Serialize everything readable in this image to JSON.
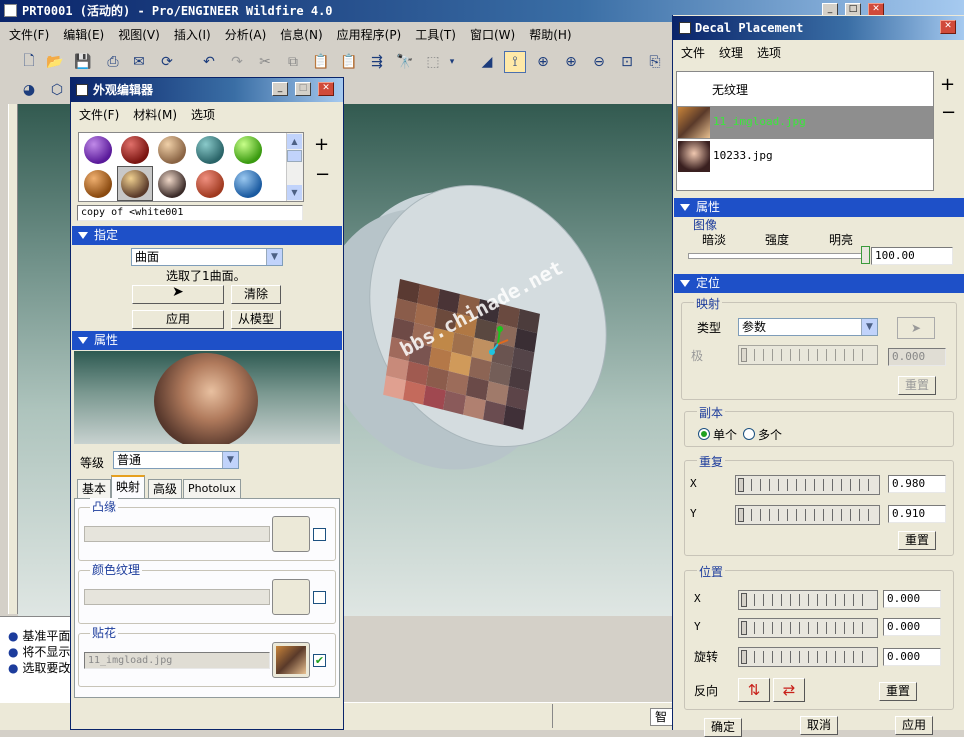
{
  "main_window": {
    "title": "PRT0001 (活动的) - Pro/ENGINEER Wildfire 4.0",
    "menu": [
      "文件(F)",
      "编辑(E)",
      "视图(V)",
      "插入(I)",
      "分析(A)",
      "信息(N)",
      "应用程序(P)",
      "工具(T)",
      "窗口(W)",
      "帮助(H)"
    ],
    "messages": [
      "基准平面",
      "将不显示",
      "选取要改"
    ],
    "status_right": "智",
    "watermark": "bbs.chinade.net"
  },
  "appearance_editor": {
    "title": "外观编辑器",
    "menu": [
      "文件(F)",
      "材料(M)",
      "选项"
    ],
    "material_name": "copy of <white001",
    "add_label": "+",
    "remove_label": "−",
    "assign": {
      "header": "指定",
      "surface_select": "曲面",
      "status": "选取了1曲面。",
      "clear_button": "清除",
      "apply_button": "应用",
      "from_model_button": "从模型"
    },
    "properties": {
      "header": "属性",
      "level_label": "等级",
      "level_value": "普通",
      "tabs": [
        "基本",
        "映射",
        "高级",
        "Photolux"
      ],
      "active_tab": "映射",
      "bump_label": "凸缘",
      "color_texture_label": "颜色纹理",
      "decal_label": "贴花",
      "decal_file": "11_imgload.jpg"
    }
  },
  "decal_placement": {
    "title": "Decal Placement",
    "menu": [
      "文件",
      "纹理",
      "选项"
    ],
    "textures": [
      {
        "name": "无纹理"
      },
      {
        "name": "11_imgload.jpg"
      },
      {
        "name": "10233.jpg"
      }
    ],
    "selected_texture": "11_imgload.jpg",
    "add_label": "+",
    "remove_label": "−",
    "properties": {
      "header": "属性",
      "image_label": "图像",
      "fade_label": "暗淡",
      "intensity_label": "强度",
      "bright_label": "明亮",
      "intensity_value": "100.00"
    },
    "orientation": {
      "header": "定位",
      "mapping_group": "映射",
      "type_label": "类型",
      "type_value": "参数",
      "pole_label": "极",
      "pole_value": "0.000",
      "mapping_reset": "重置",
      "copies_group": "副本",
      "single_label": "单个",
      "multiple_label": "多个",
      "copies_selected": "单个",
      "repeat_group": "重复",
      "repeat_x_label": "X",
      "repeat_x": "0.980",
      "repeat_y_label": "Y",
      "repeat_y": "0.910",
      "repeat_reset": "重置",
      "position_group": "位置",
      "pos_x_label": "X",
      "pos_x": "0.000",
      "pos_y_label": "Y",
      "pos_y": "0.000",
      "rotate_label": "旋转",
      "rotate": "0.000",
      "flip_label": "反向",
      "position_reset": "重置"
    },
    "buttons": {
      "ok": "确定",
      "cancel": "取消",
      "apply": "应用"
    }
  }
}
